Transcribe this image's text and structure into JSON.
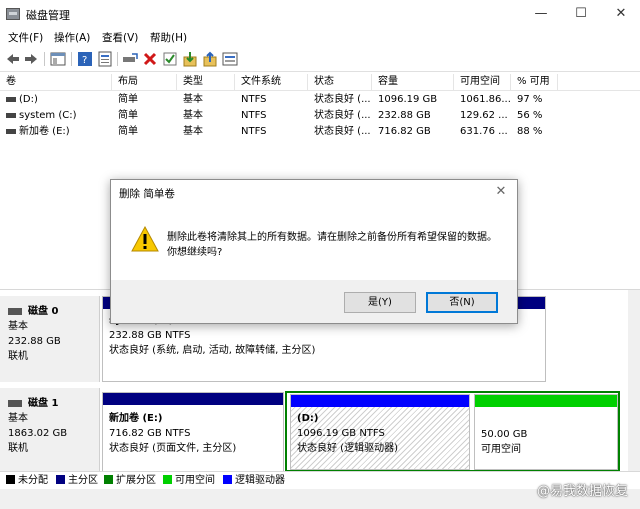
{
  "window": {
    "title": "磁盘管理",
    "minimize": "—",
    "maximize": "☐",
    "close": "✕"
  },
  "menu": [
    "文件(F)",
    "操作(A)",
    "查看(V)",
    "帮助(H)"
  ],
  "toolbar_icons": [
    "back-icon",
    "forward-icon",
    "console-icon",
    "help-icon",
    "properties-icon",
    "connect-drive-icon",
    "delete-icon",
    "check-icon",
    "import-icon",
    "export-icon",
    "view-icon"
  ],
  "volume_table": {
    "columns": [
      "卷",
      "布局",
      "类型",
      "文件系统",
      "状态",
      "容量",
      "可用空间",
      "% 可用"
    ],
    "rows": [
      [
        "(D:)",
        "简单",
        "基本",
        "NTFS",
        "状态良好 (...",
        "1096.19 GB",
        "1061.86...",
        "97 %"
      ],
      [
        "system (C:)",
        "简单",
        "基本",
        "NTFS",
        "状态良好 (...",
        "232.88 GB",
        "129.62 ...",
        "56 %"
      ],
      [
        "新加卷 (E:)",
        "简单",
        "基本",
        "NTFS",
        "状态良好 (...",
        "716.82 GB",
        "631.76 ...",
        "88 %"
      ]
    ]
  },
  "disks": [
    {
      "name": "磁盘 0",
      "type": "基本",
      "size": "232.88 GB",
      "status": "联机",
      "partitions": [
        {
          "title": "system (C:)",
          "size": "232.88 GB NTFS",
          "status": "状态良好 (系统, 启动, 活动, 故障转储, 主分区)"
        }
      ]
    },
    {
      "name": "磁盘 1",
      "type": "基本",
      "size": "1863.02 GB",
      "status": "联机",
      "partitions": [
        {
          "title": "新加卷  (E:)",
          "size": "716.82 GB NTFS",
          "status": "状态良好 (页面文件, 主分区)"
        },
        {
          "title": "(D:)",
          "size": "1096.19 GB NTFS",
          "status": "状态良好 (逻辑驱动器)"
        },
        {
          "title": "",
          "size": "50.00 GB",
          "status": "可用空间"
        }
      ]
    }
  ],
  "legend": [
    {
      "label": "未分配",
      "color": "#000000"
    },
    {
      "label": "主分区",
      "color": "#000080"
    },
    {
      "label": "扩展分区",
      "color": "#008000"
    },
    {
      "label": "可用空间",
      "color": "#00d000"
    },
    {
      "label": "逻辑驱动器",
      "color": "#0000ff"
    }
  ],
  "dialog": {
    "title": "删除 简单卷",
    "message": "删除此卷将清除其上的所有数据。请在删除之前备份所有希望保留的数据。你想继续吗?",
    "yes": "是(Y)",
    "no": "否(N)",
    "close": "✕"
  },
  "watermark": "@易我数据恢复",
  "colors": {
    "primary_partition": "#000080",
    "logical_drive": "#0000ff",
    "extended_partition": "#008000",
    "free_space": "#00d000",
    "focus_blue": "#0078d7"
  }
}
